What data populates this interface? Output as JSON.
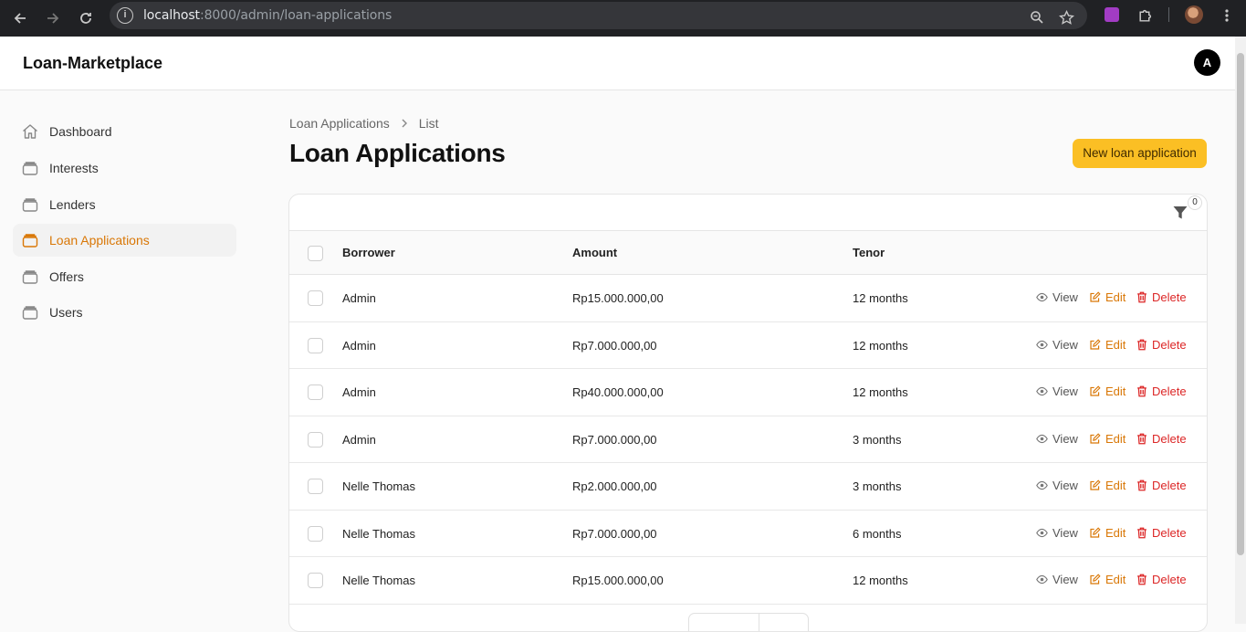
{
  "browser": {
    "url_host": "localhost",
    "url_rest": ":8000/admin/loan-applications"
  },
  "app": {
    "brand": "Loan-Marketplace",
    "user_initial": "A"
  },
  "sidebar": {
    "items": [
      {
        "label": "Dashboard",
        "icon": "home-icon"
      },
      {
        "label": "Interests",
        "icon": "stack-icon"
      },
      {
        "label": "Lenders",
        "icon": "stack-icon"
      },
      {
        "label": "Loan Applications",
        "icon": "stack-icon",
        "active": true
      },
      {
        "label": "Offers",
        "icon": "stack-icon"
      },
      {
        "label": "Users",
        "icon": "stack-icon"
      }
    ]
  },
  "breadcrumb": {
    "parent": "Loan Applications",
    "current": "List"
  },
  "page": {
    "title": "Loan Applications",
    "new_button": "New loan application"
  },
  "table": {
    "filter_count": "0",
    "columns": {
      "borrower": "Borrower",
      "amount": "Amount",
      "tenor": "Tenor"
    },
    "actions": {
      "view": "View",
      "edit": "Edit",
      "delete": "Delete"
    },
    "rows": [
      {
        "borrower": "Admin",
        "amount": "Rp15.000.000,00",
        "tenor": "12 months"
      },
      {
        "borrower": "Admin",
        "amount": "Rp7.000.000,00",
        "tenor": "12 months"
      },
      {
        "borrower": "Admin",
        "amount": "Rp40.000.000,00",
        "tenor": "12 months"
      },
      {
        "borrower": "Admin",
        "amount": "Rp7.000.000,00",
        "tenor": "3 months"
      },
      {
        "borrower": "Nelle Thomas",
        "amount": "Rp2.000.000,00",
        "tenor": "3 months"
      },
      {
        "borrower": "Nelle Thomas",
        "amount": "Rp7.000.000,00",
        "tenor": "6 months"
      },
      {
        "borrower": "Nelle Thomas",
        "amount": "Rp15.000.000,00",
        "tenor": "12 months"
      }
    ]
  },
  "colors": {
    "accent": "#d97706",
    "primary_button": "#fbbf24",
    "danger": "#dc2626"
  }
}
